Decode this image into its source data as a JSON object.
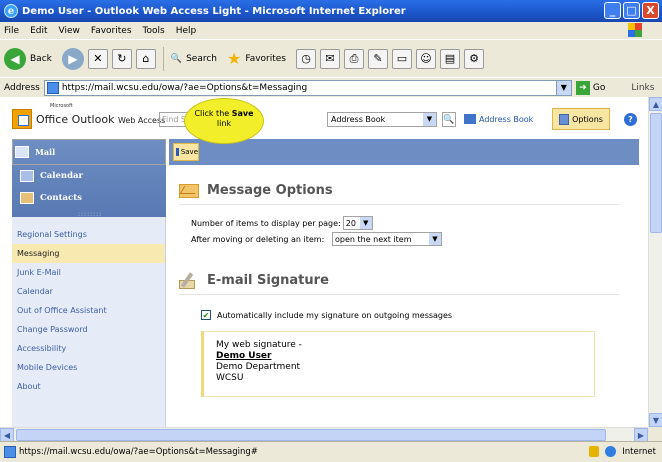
{
  "window": {
    "title": "Demo User - Outlook Web Access Light - Microsoft Internet Explorer",
    "buttons": [
      "_",
      "□",
      "X"
    ]
  },
  "menu": [
    "File",
    "Edit",
    "View",
    "Favorites",
    "Tools",
    "Help"
  ],
  "toolbar": {
    "back_label": "Back",
    "search_label": "Search",
    "favorites_label": "Favorites"
  },
  "addressbar": {
    "label": "Address",
    "url": "https://mail.wcsu.edu/owa/?ae=Options&t=Messaging",
    "go_label": "Go",
    "links_label": "Links"
  },
  "owa": {
    "ms_label": "Microsoft",
    "product_name": "Office Outlook",
    "product_suffix": "Web Access",
    "find_placeholder": "Find Someone",
    "addressbook_select": "Address Book",
    "addressbook_link": "Address Book",
    "options_label": "Options",
    "help_label": "?"
  },
  "callout": {
    "line1_prefix": "Click the",
    "line1_bold": "Save",
    "line2": "link"
  },
  "nav": {
    "top_items": [
      {
        "label": "Mail",
        "icon": "mail-icon"
      },
      {
        "label": "Calendar",
        "icon": "calendar-icon"
      },
      {
        "label": "Contacts",
        "icon": "contacts-icon"
      }
    ],
    "links": [
      {
        "label": "Regional Settings"
      },
      {
        "label": "Messaging"
      },
      {
        "label": "Junk E-Mail"
      },
      {
        "label": "Calendar"
      },
      {
        "label": "Out of Office Assistant"
      },
      {
        "label": "Change Password"
      },
      {
        "label": "Accessibility"
      },
      {
        "label": "Mobile Devices"
      },
      {
        "label": "About"
      }
    ],
    "active_link": "Messaging"
  },
  "main": {
    "save_label": "Save",
    "message_options": {
      "title": "Message Options",
      "items_per_page_label": "Number of items to display per page:",
      "items_per_page_value": "20",
      "after_delete_label": "After moving or deleting an item:",
      "after_delete_value": "open the next item"
    },
    "signature": {
      "title": "E-mail Signature",
      "auto_include_label": "Automatically include my signature on outgoing messages",
      "auto_include_checked": true,
      "text_line1": "My web signature -",
      "text_name": "Demo User",
      "text_dept": "Demo Department",
      "text_org": "WCSU"
    }
  },
  "status": {
    "url": "https://mail.wcsu.edu/owa/?ae=Options&t=Messaging#",
    "zone": "Internet"
  },
  "colors": {
    "title_bar": "#1b55c9",
    "nav_blue": "#6e8ec3",
    "active_highlight": "#f7e9b0",
    "callout_yellow": "#f2ee2a"
  }
}
